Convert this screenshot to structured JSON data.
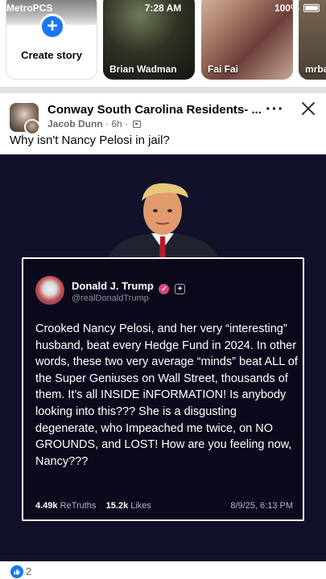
{
  "status_bar": {
    "carrier": "MetroPCS",
    "time": "7:28 AM",
    "battery": "100%"
  },
  "stories": {
    "create_label": "Create story",
    "items": [
      {
        "name": "Brian Wadman"
      },
      {
        "name": "Fai Fai"
      },
      {
        "name": "mrba"
      }
    ]
  },
  "post": {
    "group_name": "Conway South Carolina Residents- ...",
    "author": "Jacob Dunn",
    "time": "6h",
    "separator": "·",
    "more_label": "···",
    "text": "Why isn't Nancy Pelosi in jail?",
    "tweet": {
      "name": "Donald J. Trump",
      "handle": "@realDonaldTrump",
      "body": "Crooked Nancy Pelosi, and her very “interesting” husband, beat every Hedge Fund in 2024. In other words, these two very average “minds” beat ALL of the Super Geniuses on Wall Street, thousands of them. It’s all INSIDE iNFORMATION! Is anybody looking into this??? She is a disgusting degenerate, who Impeached me twice, on NO GROUNDS, and LOST! How are you feeling now, Nancy???",
      "retruths_count": "4.49k",
      "retruths_label": "ReTruths",
      "likes_count": "15.2k",
      "likes_label": "Likes",
      "date": "8/9/25, 6:13 PM"
    },
    "reaction_count": "2"
  },
  "colors": {
    "accent": "#1877f2",
    "image_background": "#12112a",
    "verified_badge": "#d5487f"
  },
  "icons": [
    "wifi-icon",
    "battery-icon",
    "plus-icon",
    "more-icon",
    "close-icon",
    "privacy-icon",
    "verified-icon",
    "like-icon"
  ]
}
